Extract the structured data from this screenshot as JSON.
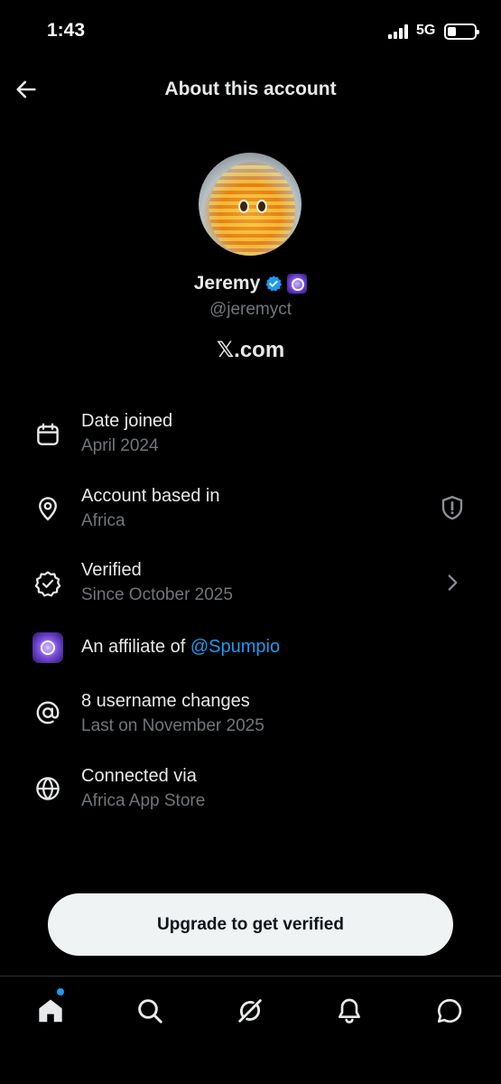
{
  "status_bar": {
    "time": "1:43",
    "network": "5G"
  },
  "header": {
    "title": "About this account",
    "back_icon": "arrow-left-icon"
  },
  "profile": {
    "display_name": "Jeremy",
    "handle": "@jeremyct",
    "verified_color": "#1d9bf0",
    "site": "𝕏.com"
  },
  "info": {
    "date_joined": {
      "icon": "calendar-icon",
      "title": "Date joined",
      "value": "April 2024"
    },
    "based_in": {
      "icon": "location-pin-icon",
      "title": "Account based in",
      "value": "Africa",
      "trailing_icon": "shield-icon"
    },
    "verified": {
      "icon": "verified-badge-outline-icon",
      "title": "Verified",
      "value": "Since October 2025",
      "trailing_icon": "chevron-right-icon"
    },
    "affiliate": {
      "icon": "affiliate-logo-icon",
      "prefix": "An affiliate of ",
      "link": "@Spumpio"
    },
    "username_changes": {
      "icon": "at-sign-icon",
      "title": "8 username changes",
      "value": "Last on November 2025"
    },
    "connected": {
      "icon": "globe-icon",
      "title": "Connected via",
      "value": "Africa App Store"
    }
  },
  "upgrade_button": {
    "label": "Upgrade to get verified",
    "bg": "#eff3f4"
  },
  "tab_bar": {
    "tabs": [
      "home-icon",
      "search-icon",
      "grok-icon",
      "bell-icon",
      "messages-icon"
    ],
    "accent": "#1d9bf0"
  }
}
